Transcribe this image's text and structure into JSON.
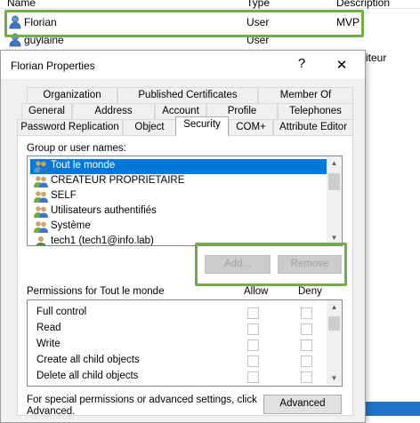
{
  "background": {
    "columns": [
      "Name",
      "Type",
      "Description"
    ],
    "rows": [
      {
        "name": "Florian",
        "type": "User",
        "description": "MVP"
      },
      {
        "name": "guylaine",
        "type": "User",
        "description": ""
      }
    ],
    "side_text": "iteur",
    "accent_color": "#70ad47"
  },
  "dialog": {
    "title": "Florian Properties",
    "help_glyph": "?",
    "close_glyph": "✕",
    "tabs_row1": [
      "Organization",
      "Published Certificates",
      "Member Of"
    ],
    "tabs_row2": [
      "General",
      "Address",
      "Account",
      "Profile",
      "Telephones"
    ],
    "tabs_row3": [
      "Password Replication",
      "Object",
      "Security",
      "COM+",
      "Attribute Editor"
    ],
    "active_tab": "Security",
    "group_label": "Group or user names:",
    "principals": [
      {
        "name": "Tout le monde",
        "icon": "group-icon",
        "selected": true
      },
      {
        "name": "CREATEUR PROPRIETAIRE",
        "icon": "group-icon",
        "selected": false
      },
      {
        "name": "SELF",
        "icon": "group-icon",
        "selected": false
      },
      {
        "name": "Utilisateurs authentifiés",
        "icon": "group-icon",
        "selected": false
      },
      {
        "name": "Système",
        "icon": "group-icon",
        "selected": false
      },
      {
        "name": "tech1 (tech1@info.lab)",
        "icon": "user-icon",
        "selected": false
      }
    ],
    "add_button": "Add...",
    "remove_button": "Remove",
    "permissions_label": "Permissions for Tout le monde",
    "allow_label": "Allow",
    "deny_label": "Deny",
    "permissions": [
      "Full control",
      "Read",
      "Write",
      "Create all child objects",
      "Delete all child objects"
    ],
    "note": "For special permissions or advanced settings, click Advanced.",
    "advanced_button": "Advanced"
  }
}
